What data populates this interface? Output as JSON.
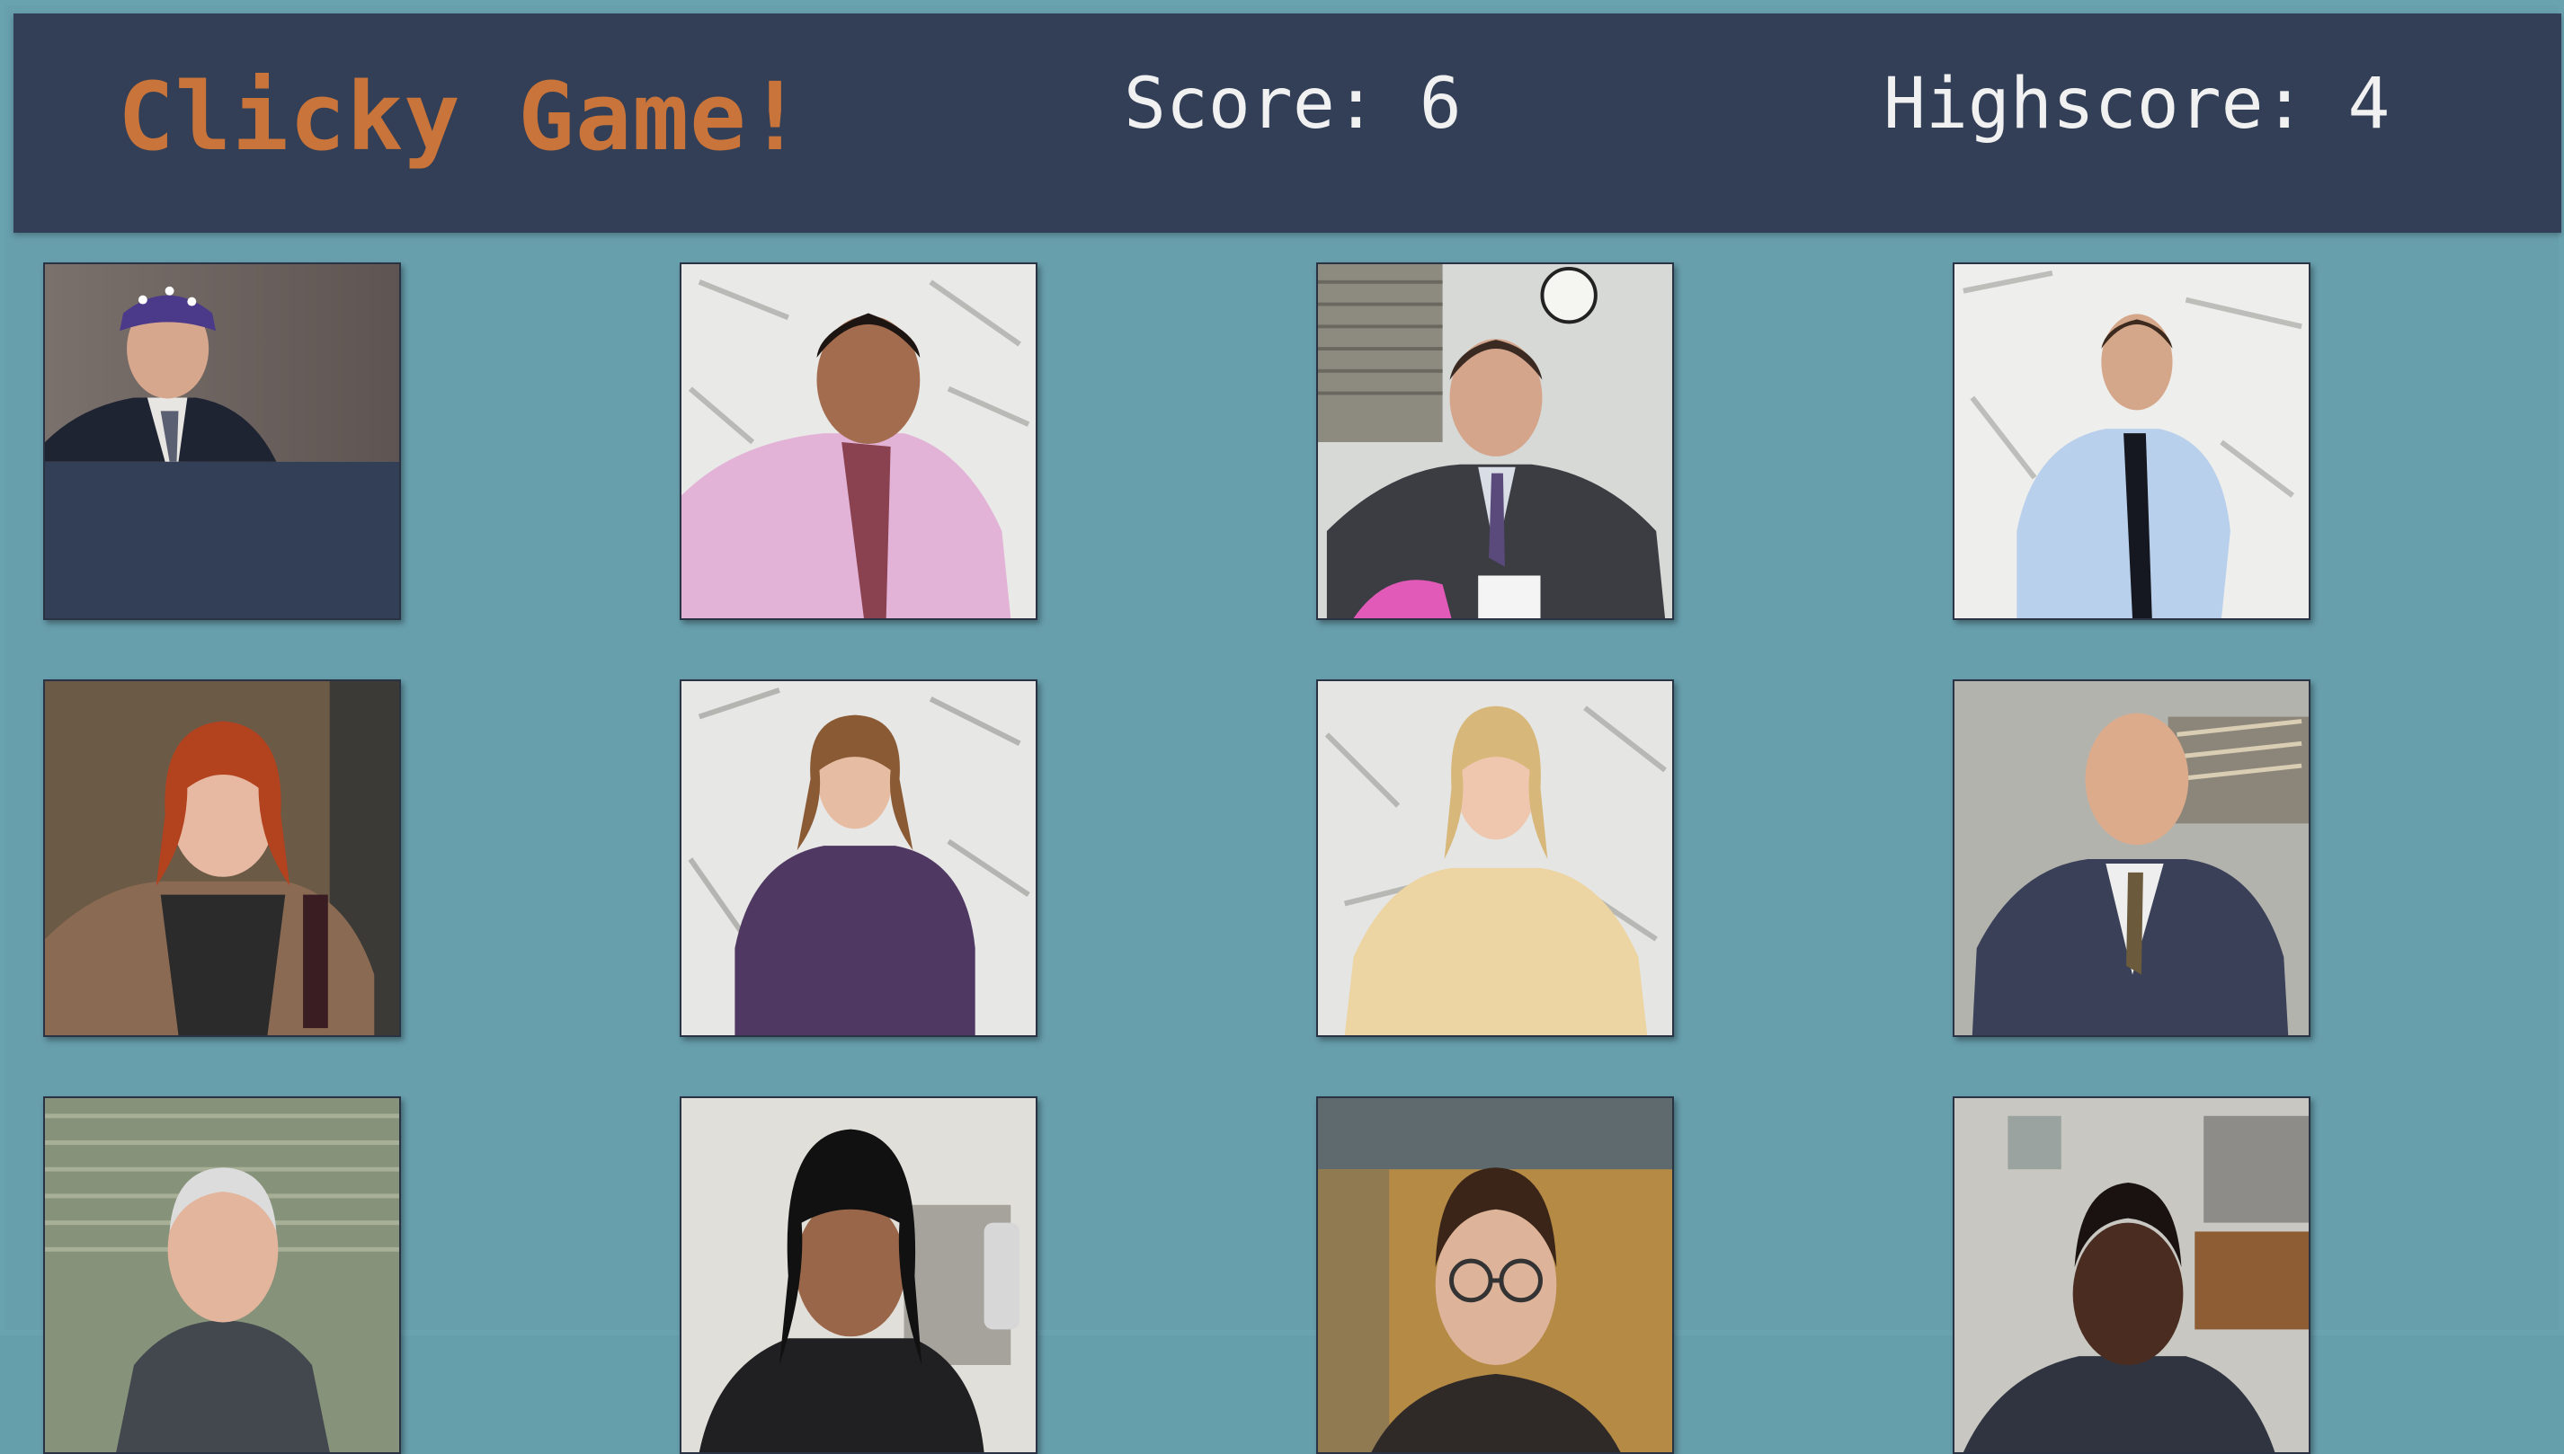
{
  "header": {
    "title": "Clicky Game!",
    "score_text": "Score: 6",
    "highscore_text": "Highscore: 4",
    "score": 6,
    "highscore": 4
  },
  "colors": {
    "page_bg": "#669fac",
    "header_bg": "#323f56",
    "title": "#c9743a",
    "score_text": "#f1f1f1"
  },
  "cards": [
    {
      "name": "character-card",
      "icon": "portrait-bandana-man"
    },
    {
      "name": "character-card",
      "icon": "portrait-man-pink-shirt"
    },
    {
      "name": "character-card",
      "icon": "portrait-man-suit-mug"
    },
    {
      "name": "character-card",
      "icon": "portrait-man-blue-shirt"
    },
    {
      "name": "character-card",
      "icon": "portrait-redhead-woman"
    },
    {
      "name": "character-card",
      "icon": "portrait-woman-purple-top"
    },
    {
      "name": "character-card",
      "icon": "portrait-blonde-woman"
    },
    {
      "name": "character-card",
      "icon": "portrait-bald-man-desk"
    },
    {
      "name": "character-card",
      "icon": "portrait-older-man"
    },
    {
      "name": "character-card",
      "icon": "portrait-dark-hair-woman"
    },
    {
      "name": "character-card",
      "icon": "portrait-man-glasses"
    },
    {
      "name": "character-card",
      "icon": "portrait-man-office"
    }
  ]
}
